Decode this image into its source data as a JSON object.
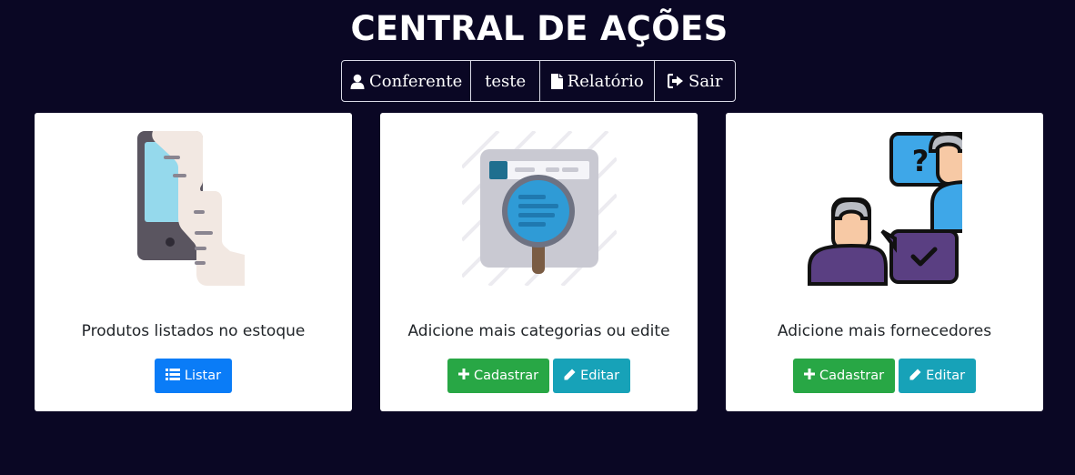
{
  "page": {
    "title": "CENTRAL DE AÇÕES"
  },
  "nav": {
    "items": [
      {
        "label": "Conferente",
        "icon": "user-icon"
      },
      {
        "label": "teste",
        "icon": ""
      },
      {
        "label": "Relatório",
        "icon": "file-icon"
      },
      {
        "label": "Sair",
        "icon": "sign-out-icon"
      }
    ]
  },
  "cards": [
    {
      "image": "stock-list-illustration",
      "text": "Produtos listados no estoque",
      "buttons": [
        {
          "label": "Listar",
          "icon": "list-icon",
          "color": "#0a7cf7"
        }
      ]
    },
    {
      "image": "category-search-illustration",
      "text": "Adicione mais categorias ou edite",
      "buttons": [
        {
          "label": "Cadastrar",
          "icon": "plus-icon",
          "color": "#28a745"
        },
        {
          "label": "Editar",
          "icon": "pencil-icon",
          "color": "#17a2b8"
        }
      ]
    },
    {
      "image": "suppliers-illustration",
      "text": "Adicione mais fornecedores",
      "buttons": [
        {
          "label": "Cadastrar",
          "icon": "plus-icon",
          "color": "#28a745"
        },
        {
          "label": "Editar",
          "icon": "pencil-icon",
          "color": "#17a2b8"
        }
      ]
    }
  ],
  "colors": {
    "background": "#0a0724",
    "card": "#ffffff",
    "primary": "#0a7cf7",
    "success": "#28a745",
    "info": "#17a2b8"
  }
}
